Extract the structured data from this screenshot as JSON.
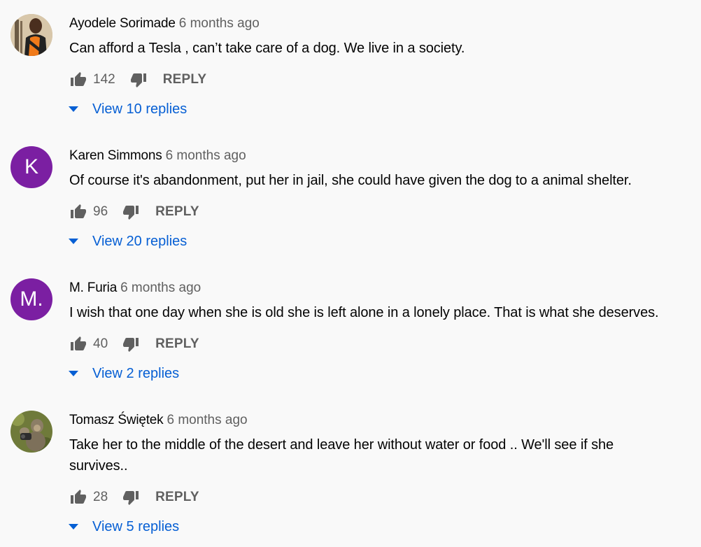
{
  "comments": [
    {
      "author": "Ayodele Sorimade",
      "time": "6 months ago",
      "text": "Can afford a Tesla , can’t take care of a dog. We live in a society.",
      "likes": "142",
      "reply_label": "REPLY",
      "view_replies": "View 10 replies",
      "avatar": {
        "type": "photo",
        "icon": "person-photo"
      }
    },
    {
      "author": "Karen Simmons",
      "time": "6 months ago",
      "text": "Of course it's abandonment, put her in jail, she could have given the dog to a animal shelter.",
      "likes": "96",
      "reply_label": "REPLY",
      "view_replies": "View 20 replies",
      "avatar": {
        "type": "letter",
        "letter": "K",
        "color": "#7b1fa2"
      }
    },
    {
      "author": "M. Furia",
      "time": "6 months ago",
      "text": "I wish that one day when she is old she is left alone in a lonely place. That is what she deserves.",
      "likes": "40",
      "reply_label": "REPLY",
      "view_replies": "View 2 replies",
      "avatar": {
        "type": "letter",
        "letter": "M.",
        "color": "#7b1fa2"
      }
    },
    {
      "author": "Tomasz Świętek",
      "time": "6 months ago",
      "text": "Take her to the middle of the desert and leave her without water or food .. We'll see if she survives..",
      "likes": "28",
      "reply_label": "REPLY",
      "view_replies": "View 5 replies",
      "avatar": {
        "type": "photo",
        "icon": "monkey-photo"
      }
    }
  ],
  "colors": {
    "background": "#f9f9f9",
    "link": "#065fd4",
    "secondary": "#606060",
    "avatar_letter_bg": "#7b1fa2"
  }
}
